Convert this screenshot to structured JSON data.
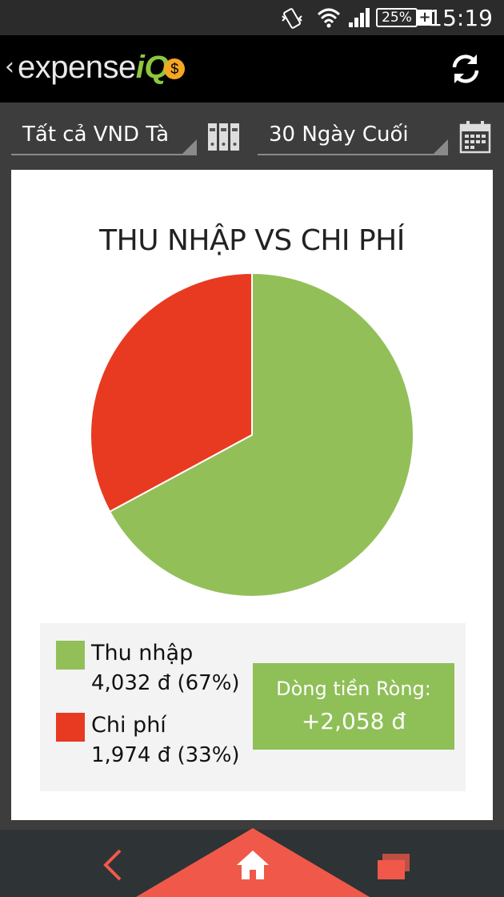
{
  "status_bar": {
    "battery": "25%",
    "time": "15:19",
    "icons": [
      "vibrate-icon",
      "wifi-icon",
      "signal-icon",
      "battery-icon"
    ]
  },
  "app_bar": {
    "logo_text": "expense",
    "logo_iq": "iQ",
    "logo_dollar": "$",
    "back_glyph": "‹",
    "icons": [
      "back-chevron-icon",
      "refresh-icon"
    ]
  },
  "filters": {
    "account": "Tất cả VND Tà",
    "range": "30 Ngày Cuối",
    "icons": [
      "books-icon",
      "calendar-icon"
    ]
  },
  "chart_data": {
    "type": "pie",
    "title": "THU NHẬP VS CHI PHÍ",
    "slices": [
      {
        "name": "Thu nhập",
        "value": 4032,
        "percent": 67,
        "color": "#93bf59",
        "label": "4,032 đ (67%)"
      },
      {
        "name": "Chi phí",
        "value": 1974,
        "percent": 33,
        "color": "#e83a20",
        "label": "1,974 đ (33%)"
      }
    ],
    "start": "top",
    "direction": "clockwise"
  },
  "net": {
    "label": "Dòng tiền Ròng:",
    "value": "+2,058 đ"
  },
  "nav": {
    "icons": [
      "back-icon",
      "home-icon",
      "recents-icon"
    ],
    "accent": "#f0594a"
  }
}
